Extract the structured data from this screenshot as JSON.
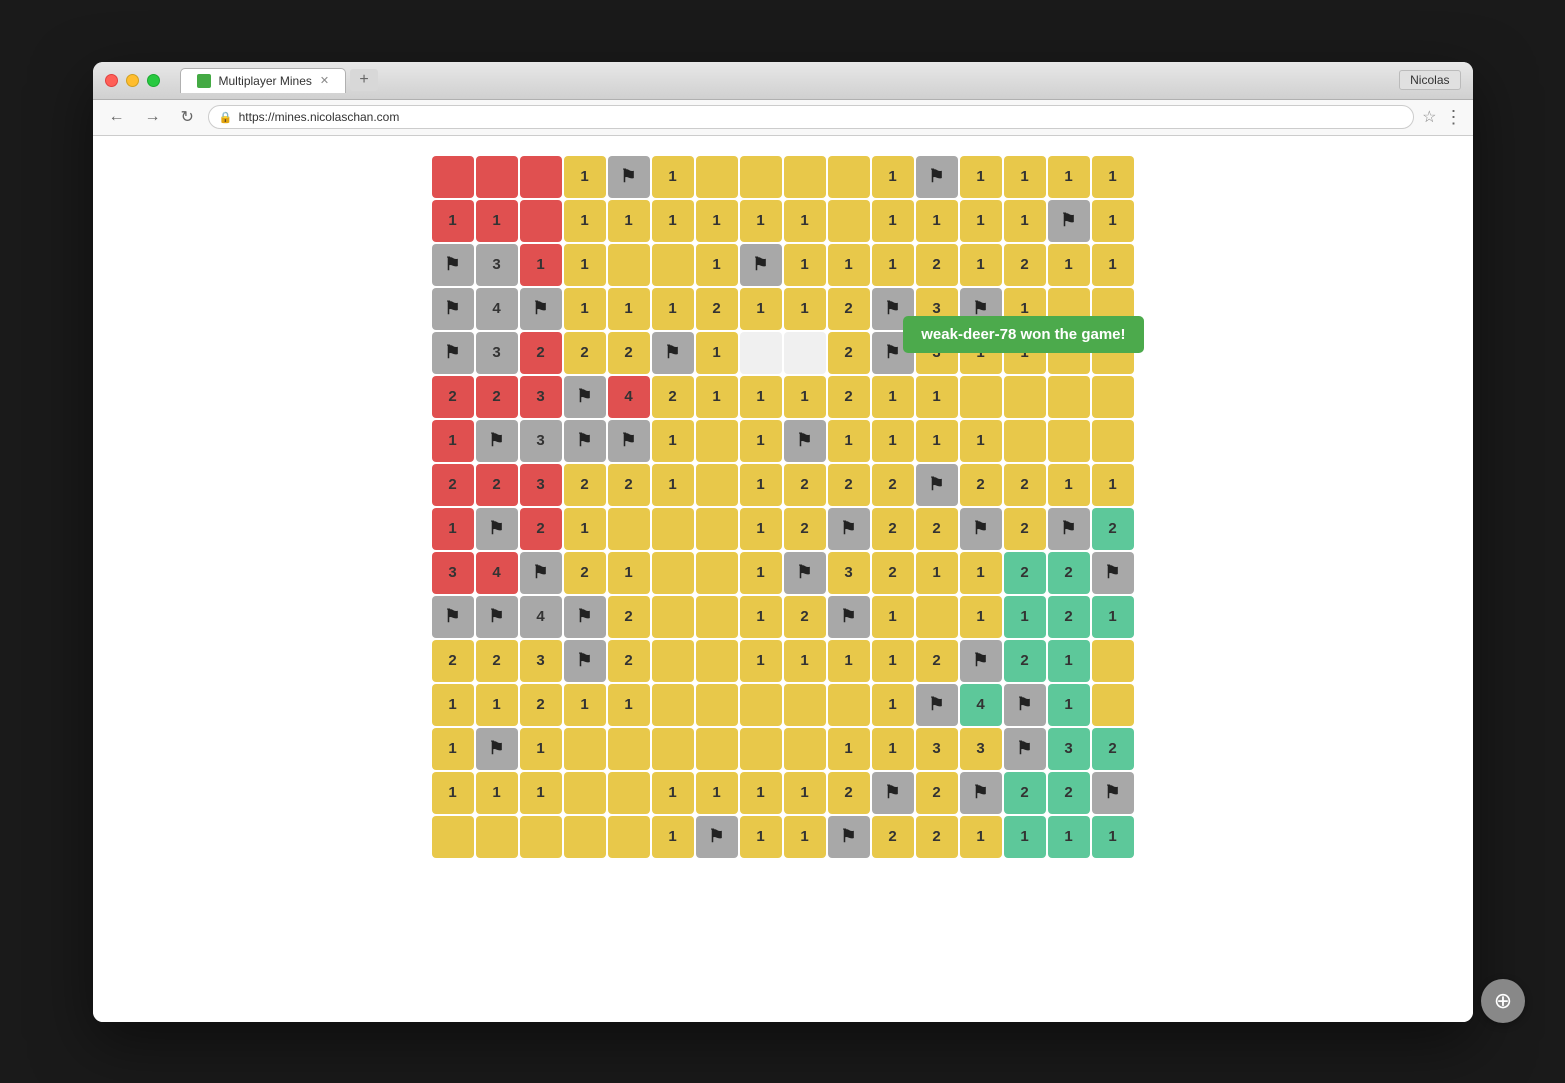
{
  "browser": {
    "title": "Multiplayer Mines",
    "url": "https://mines.nicolaschan.com",
    "user": "Nicolas",
    "tab_title": "Multiplayer Mines"
  },
  "win_banner": {
    "text": "weak-deer-78 won the game!"
  },
  "fab_label": "+",
  "grid": {
    "rows": 16,
    "cols": 16,
    "cells": [
      [
        "red",
        "red",
        "red",
        "yellow-1",
        "gray-flag",
        "yellow-1",
        "yellow",
        "yellow",
        "yellow",
        "yellow",
        "yellow-1",
        "gray-flag",
        "yellow-1",
        "yellow-1",
        "yellow-1",
        "yellow-1"
      ],
      [
        "red-1",
        "red-1",
        "red",
        "yellow-1",
        "yellow-1",
        "yellow-1",
        "yellow-1",
        "yellow-1",
        "yellow-1",
        "yellow",
        "yellow-1",
        "yellow-1",
        "yellow-1",
        "yellow-1",
        "gray-flag",
        "yellow-1"
      ],
      [
        "gray-flag",
        "gray-3",
        "red-1",
        "yellow-1",
        "yellow",
        "yellow",
        "yellow-1",
        "gray-flag",
        "yellow-1",
        "yellow-1",
        "yellow-1",
        "yellow-2",
        "yellow-1",
        "yellow-2",
        "yellow-1",
        "yellow-1"
      ],
      [
        "gray-flag",
        "gray-4",
        "gray-flag",
        "yellow-1",
        "yellow-1",
        "yellow-1",
        "yellow-2",
        "yellow-1",
        "yellow-1",
        "yellow-2",
        "gray-flag",
        "yellow-3",
        "gray-flag",
        "yellow-1",
        "yellow",
        "yellow"
      ],
      [
        "gray-flag",
        "gray-3",
        "red-2",
        "yellow-2",
        "yellow-2",
        "gray-flag",
        "yellow-1",
        "white",
        "white",
        "yellow-2",
        "gray-flag",
        "yellow-3",
        "yellow-1",
        "yellow-1",
        "yellow",
        "yellow"
      ],
      [
        "red-2",
        "red-2",
        "red-3",
        "gray-flag",
        "red-4",
        "yellow-2",
        "yellow-1",
        "yellow-1",
        "yellow-1",
        "yellow-2",
        "yellow-1",
        "yellow-1",
        "yellow",
        "yellow",
        "yellow",
        "yellow"
      ],
      [
        "red-1",
        "gray-flag",
        "gray-3",
        "gray-flag",
        "gray-flag",
        "yellow-1",
        "yellow",
        "yellow-1",
        "gray-flag",
        "yellow-1",
        "yellow-1",
        "yellow-1",
        "yellow-1",
        "yellow",
        "yellow",
        "yellow"
      ],
      [
        "red-2",
        "red-2",
        "red-3",
        "yellow-2",
        "yellow-2",
        "yellow-1",
        "yellow",
        "yellow-1",
        "yellow-2",
        "yellow-2",
        "yellow-2",
        "gray-flag",
        "yellow-2",
        "yellow-2",
        "yellow-1",
        "yellow-1"
      ],
      [
        "red-1",
        "gray-flag",
        "red-2",
        "yellow-1",
        "yellow",
        "yellow",
        "yellow",
        "yellow-1",
        "yellow-2",
        "gray-flag",
        "yellow-2",
        "yellow-2",
        "gray-flag",
        "yellow-2",
        "gray-flag",
        "green-2"
      ],
      [
        "red-3",
        "red-4",
        "gray-flag",
        "yellow-2",
        "yellow-1",
        "yellow",
        "yellow",
        "yellow-1",
        "gray-flag",
        "yellow-3",
        "yellow-2",
        "yellow-1",
        "yellow-1",
        "green-2",
        "green-2",
        "gray-flag"
      ],
      [
        "gray-flag",
        "gray-flag",
        "gray-4",
        "gray-flag",
        "yellow-2",
        "yellow",
        "yellow",
        "yellow-1",
        "yellow-2",
        "gray-flag",
        "yellow-1",
        "yellow",
        "yellow-1",
        "green-1",
        "green-2",
        "green-1"
      ],
      [
        "yellow-2",
        "yellow-2",
        "yellow-3",
        "gray-flag",
        "yellow-2",
        "yellow",
        "yellow",
        "yellow-1",
        "yellow-1",
        "yellow-1",
        "yellow-1",
        "yellow-2",
        "gray-flag",
        "green-2",
        "green-1",
        "yellow"
      ],
      [
        "yellow-1",
        "yellow-1",
        "yellow-2",
        "yellow-1",
        "yellow-1",
        "yellow",
        "yellow",
        "yellow",
        "yellow",
        "yellow",
        "yellow-1",
        "gray-flag",
        "green-4",
        "gray-flag",
        "green-1",
        "yellow"
      ],
      [
        "yellow-1",
        "gray-flag",
        "yellow-1",
        "yellow",
        "yellow",
        "yellow",
        "yellow",
        "yellow",
        "yellow",
        "yellow-1",
        "yellow-1",
        "yellow-3",
        "yellow-3",
        "gray-flag",
        "green-3",
        "green-2"
      ],
      [
        "yellow-1",
        "yellow-1",
        "yellow-1",
        "yellow",
        "yellow",
        "yellow-1",
        "yellow-1",
        "yellow-1",
        "yellow-1",
        "yellow-2",
        "gray-flag",
        "yellow-2",
        "gray-flag",
        "green-2",
        "green-2",
        "gray-flag"
      ],
      [
        "yellow",
        "yellow",
        "yellow",
        "yellow",
        "yellow",
        "yellow-1",
        "gray-flag",
        "yellow-1",
        "yellow-1",
        "gray-flag",
        "yellow-2",
        "yellow-2",
        "yellow-1",
        "green-1",
        "green-1",
        "green-1"
      ]
    ]
  }
}
